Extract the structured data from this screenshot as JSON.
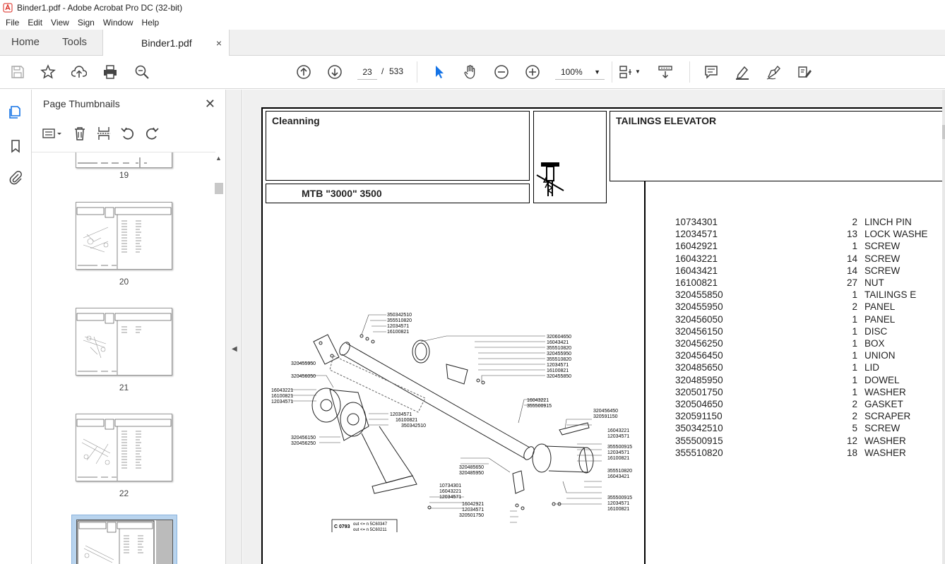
{
  "window": {
    "title": "Binder1.pdf - Adobe Acrobat Pro DC (32-bit)"
  },
  "menu": [
    "File",
    "Edit",
    "View",
    "Sign",
    "Window",
    "Help"
  ],
  "tabs": {
    "home": "Home",
    "tools": "Tools",
    "document": "Binder1.pdf",
    "close": "×"
  },
  "toolbar": {
    "current_page": "23",
    "page_sep": "/",
    "total_pages": "533",
    "zoom": "100%"
  },
  "panel": {
    "title": "Page Thumbnails",
    "thumbnails": [
      "19",
      "20",
      "21",
      "22"
    ]
  },
  "document": {
    "section": "Cleanning",
    "model": "MTB \"3000\" 3500",
    "group_title": "TAILINGS ELEVATOR",
    "parts": [
      {
        "number": "10734301",
        "qty": "2",
        "desc": "LINCH PIN"
      },
      {
        "number": "12034571",
        "qty": "13",
        "desc": "LOCK WASHE"
      },
      {
        "number": "16042921",
        "qty": "1",
        "desc": "SCREW"
      },
      {
        "number": "16043221",
        "qty": "14",
        "desc": "SCREW"
      },
      {
        "number": "16043421",
        "qty": "14",
        "desc": "SCREW"
      },
      {
        "number": "16100821",
        "qty": "27",
        "desc": "NUT"
      },
      {
        "number": "320455850",
        "qty": "1",
        "desc": "TAILINGS E"
      },
      {
        "number": "320455950",
        "qty": "2",
        "desc": "PANEL"
      },
      {
        "number": "320456050",
        "qty": "1",
        "desc": "PANEL"
      },
      {
        "number": "320456150",
        "qty": "1",
        "desc": "DISC"
      },
      {
        "number": "320456250",
        "qty": "1",
        "desc": "BOX"
      },
      {
        "number": "320456450",
        "qty": "1",
        "desc": "UNION"
      },
      {
        "number": "320485650",
        "qty": "1",
        "desc": "LID"
      },
      {
        "number": "320485950",
        "qty": "1",
        "desc": "DOWEL"
      },
      {
        "number": "320501750",
        "qty": "1",
        "desc": "WASHER"
      },
      {
        "number": "320504650",
        "qty": "2",
        "desc": "GASKET"
      },
      {
        "number": "320591150",
        "qty": "2",
        "desc": "SCRAPER"
      },
      {
        "number": "350342510",
        "qty": "5",
        "desc": "SCREW"
      },
      {
        "number": "355500915",
        "qty": "12",
        "desc": "WASHER"
      },
      {
        "number": "355510820",
        "qty": "18",
        "desc": "WASHER"
      }
    ],
    "diagram_labels": {
      "top_left": [
        "350342510",
        "355510820",
        "12034571",
        "16100821"
      ],
      "top_right": [
        "320604650",
        "16043421",
        "355510820",
        "320455950",
        "355510820",
        "12034571",
        "16100821",
        "320455850"
      ],
      "left": [
        "320455950",
        "320456050",
        "16043221",
        "16100821",
        "12034571"
      ],
      "mid": [
        "16043221",
        "355500915",
        "12034571",
        "16100821",
        "350342510"
      ],
      "disc": [
        "320456150",
        "320456250"
      ],
      "right": [
        "320456450",
        "320591150",
        "16043221",
        "12034571",
        "355500915",
        "12034571",
        "16100821",
        "355510820",
        "16043421",
        "355500915",
        "12034571",
        "16100821"
      ],
      "bottom": [
        "320485650",
        "320485950",
        "10734301",
        "16043221",
        "12034571",
        "16042921",
        "12034571",
        "320501750"
      ],
      "note_code": "C 0793",
      "note_line1": "out <= n 5C60347",
      "note_line2": "out <= n 5C60211"
    }
  }
}
